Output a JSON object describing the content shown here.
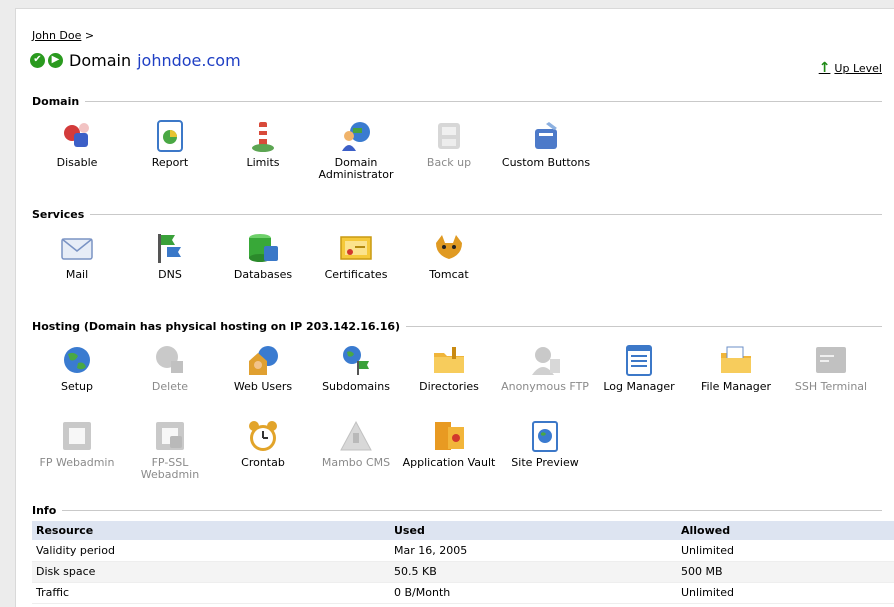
{
  "breadcrumb": {
    "user": "John Doe",
    "separator": ">"
  },
  "title": {
    "prefix": "Domain",
    "domain": "johndoe.com"
  },
  "up_level": {
    "label": "Up Level"
  },
  "sections": {
    "domain": "Domain",
    "services": "Services",
    "hosting": "Hosting (Domain has physical hosting on IP 203.142.16.16)",
    "info": "Info"
  },
  "domain_tools": [
    {
      "label": "Disable",
      "enabled": true
    },
    {
      "label": "Report",
      "enabled": true
    },
    {
      "label": "Limits",
      "enabled": true
    },
    {
      "label": "Domain Administrator",
      "enabled": true
    },
    {
      "label": "Back up",
      "enabled": false
    },
    {
      "label": "Custom Buttons",
      "enabled": true
    }
  ],
  "service_tools": [
    {
      "label": "Mail"
    },
    {
      "label": "DNS"
    },
    {
      "label": "Databases"
    },
    {
      "label": "Certificates"
    },
    {
      "label": "Tomcat"
    }
  ],
  "hosting_tools": [
    {
      "label": "Setup",
      "enabled": true
    },
    {
      "label": "Delete",
      "enabled": false
    },
    {
      "label": "Web Users",
      "enabled": true
    },
    {
      "label": "Subdomains",
      "enabled": true
    },
    {
      "label": "Directories",
      "enabled": true
    },
    {
      "label": "Anonymous FTP",
      "enabled": false
    },
    {
      "label": "Log Manager",
      "enabled": true
    },
    {
      "label": "File Manager",
      "enabled": true
    },
    {
      "label": "SSH Terminal",
      "enabled": false
    },
    {
      "label": "FP Webadmin",
      "enabled": false
    },
    {
      "label": "FP-SSL Webadmin",
      "enabled": false
    },
    {
      "label": "Crontab",
      "enabled": true
    },
    {
      "label": "Mambo CMS",
      "enabled": false
    },
    {
      "label": "Application Vault",
      "enabled": true
    },
    {
      "label": "Site Preview",
      "enabled": true
    }
  ],
  "info_table": {
    "headers": [
      "Resource",
      "Used",
      "Allowed"
    ],
    "rows": [
      [
        "Validity period",
        "Mar 16, 2005",
        "Unlimited"
      ],
      [
        "Disk space",
        "50.5 KB",
        "500 MB"
      ],
      [
        "Traffic",
        "0 B/Month",
        "Unlimited"
      ]
    ]
  }
}
